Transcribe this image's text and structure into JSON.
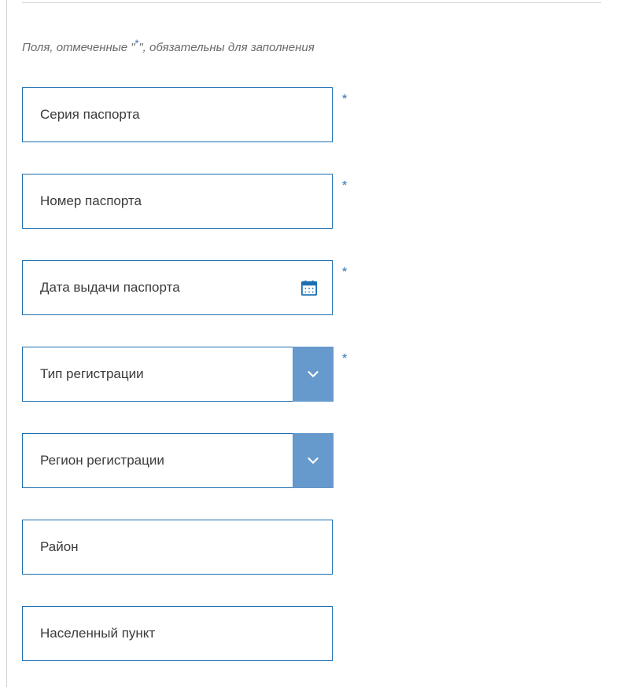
{
  "hint_prefix": "Поля, отмеченные \"",
  "hint_marker": "*",
  "hint_suffix": "\", обязательны для заполнения",
  "required_marker": "*",
  "fields": {
    "passport_series": {
      "placeholder": "Серия паспорта"
    },
    "passport_number": {
      "placeholder": "Номер паспорта"
    },
    "passport_date": {
      "placeholder": "Дата выдачи паспорта"
    },
    "reg_type": {
      "placeholder": "Тип регистрации"
    },
    "reg_region": {
      "placeholder": "Регион регистрации"
    },
    "district": {
      "placeholder": "Район"
    },
    "locality": {
      "placeholder": "Населенный пункт"
    }
  },
  "colors": {
    "border": "#1e6fb0",
    "dropdown_bg": "#6699cc",
    "asterisk": "#5a8fc7"
  }
}
